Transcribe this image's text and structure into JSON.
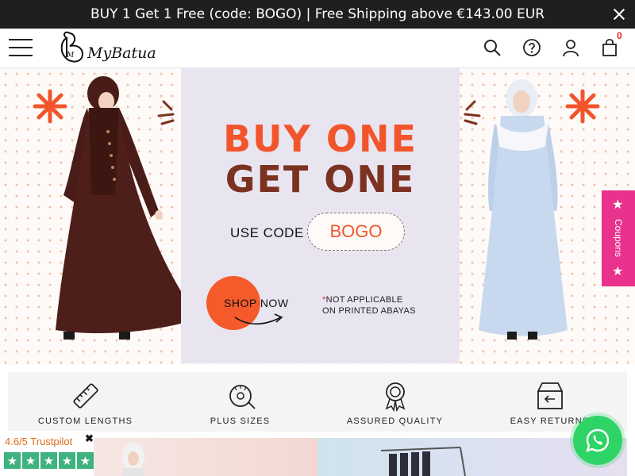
{
  "announcement": {
    "text": "BUY 1 Get 1 Free (code: BOGO) | Free Shipping above €143.00 EUR"
  },
  "header": {
    "logo_text": "MyBatua",
    "cart_count": "0"
  },
  "hero": {
    "line1": "BUY ONE",
    "line2": "GET ONE",
    "use_code_label": "USE CODE",
    "code": "BOGO",
    "shop_now": "SHOP NOW",
    "notice_star": "*",
    "notice_line1": "NOT APPLICABLE",
    "notice_line2": "ON PRINTED ABAYAS"
  },
  "coupons": {
    "label": "Coupons"
  },
  "features": [
    {
      "label": "CUSTOM LENGTHS",
      "icon": "ruler-icon"
    },
    {
      "label": "PLUS SIZES",
      "icon": "measuring-tape-icon"
    },
    {
      "label": "ASSURED QUALITY",
      "icon": "quality-badge-icon"
    },
    {
      "label": "EASY RETURNS",
      "icon": "return-box-icon"
    }
  ],
  "trustpilot": {
    "rating": "4.6/5 Trustpilot",
    "close": "✖",
    "star": "★"
  },
  "colors": {
    "accent": "#f2552b",
    "brown": "#7b3220",
    "coupon": "#e8328b",
    "whatsapp": "#2fd466",
    "trust_green": "#3fb27f"
  }
}
